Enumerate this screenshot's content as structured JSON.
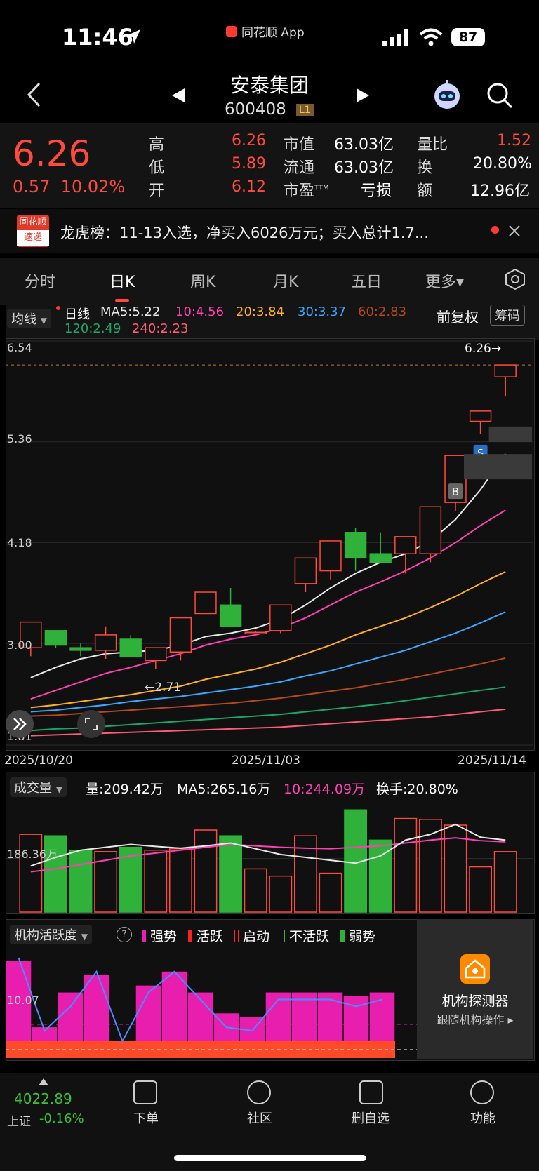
{
  "status": {
    "time": "11:46",
    "app": "同花顺 App",
    "battery": "87"
  },
  "header": {
    "title": "安泰集团",
    "code": "600408",
    "level": "L1"
  },
  "quote": {
    "price": "6.26",
    "change": "0.57",
    "pct": "10.02%",
    "high_label": "高",
    "high": "6.26",
    "low_label": "低",
    "low": "5.89",
    "open_label": "开",
    "open": "6.12",
    "mktcap_label": "市值",
    "mktcap": "63.03亿",
    "float_label": "流通",
    "float": "63.03亿",
    "pe_label": "市盈",
    "pe_sup": "TTM",
    "pe": "亏损",
    "volratio_label": "量比",
    "volratio": "1.52",
    "turnover_label": "换",
    "turnover": "20.80%",
    "amount_label": "额",
    "amount": "12.96亿"
  },
  "news": {
    "badge_top": "同花顺",
    "badge_bottom": "速递",
    "text": "龙虎榜：11-13入选，净买入6026万元；买入总计1.7..."
  },
  "tabs": [
    "分时",
    "日K",
    "周K",
    "月K",
    "五日",
    "更多▾"
  ],
  "active_tab": "日K",
  "indicators": {
    "selector": "均线",
    "period": "日线",
    "ma5": "MA5:5.22",
    "ma10": "10:4.56",
    "ma20": "20:3.84",
    "ma30": "30:3.37",
    "ma60": "60:2.83",
    "ma120": "120:2.49",
    "ma240": "240:2.23",
    "adjust": "前复权",
    "chips": "筹码"
  },
  "colors": {
    "up": "#ff4a3d",
    "down": "#2fb13a",
    "ma5": "#e8e8e8",
    "ma10": "#ff3fb4",
    "ma20": "#ffb020",
    "ma30": "#3aa7ff",
    "ma60": "#b84a1a",
    "ma120": "#1aa86a",
    "ma240": "#ff5a7a"
  },
  "chart_data": [
    {
      "type": "candlestick",
      "y_ticks": [
        "6.54",
        "5.36",
        "4.18",
        "3.00",
        "1.81"
      ],
      "ylim": [
        1.81,
        6.54
      ],
      "x_labels": [
        "2025/10/20",
        "2025/11/03",
        "2025/11/14"
      ],
      "last_price_marker": "6.26→",
      "low_marker": "←2.71",
      "trade_markers": [
        "B",
        "S"
      ],
      "candles": [
        {
          "o": 2.95,
          "h": 3.25,
          "l": 2.85,
          "c": 3.25
        },
        {
          "o": 3.15,
          "h": 3.15,
          "l": 2.95,
          "c": 2.98
        },
        {
          "o": 2.95,
          "h": 3.0,
          "l": 2.85,
          "c": 2.92
        },
        {
          "o": 2.92,
          "h": 3.2,
          "l": 2.82,
          "c": 3.1
        },
        {
          "o": 3.05,
          "h": 3.1,
          "l": 2.85,
          "c": 2.85
        },
        {
          "o": 2.8,
          "h": 2.95,
          "l": 2.7,
          "c": 2.95
        },
        {
          "o": 2.9,
          "h": 3.3,
          "l": 2.8,
          "c": 3.3
        },
        {
          "o": 3.35,
          "h": 3.6,
          "l": 3.35,
          "c": 3.6
        },
        {
          "o": 3.45,
          "h": 3.65,
          "l": 3.2,
          "c": 3.2
        },
        {
          "o": 3.12,
          "h": 3.15,
          "l": 3.1,
          "c": 3.13
        },
        {
          "o": 3.15,
          "h": 3.45,
          "l": 3.12,
          "c": 3.45
        },
        {
          "o": 3.7,
          "h": 4.0,
          "l": 3.6,
          "c": 4.0
        },
        {
          "o": 3.85,
          "h": 4.2,
          "l": 3.75,
          "c": 4.2
        },
        {
          "o": 4.3,
          "h": 4.35,
          "l": 3.85,
          "c": 4.0
        },
        {
          "o": 4.05,
          "h": 4.3,
          "l": 3.95,
          "c": 3.95
        },
        {
          "o": 4.05,
          "h": 4.25,
          "l": 3.82,
          "c": 4.25
        },
        {
          "o": 4.05,
          "h": 4.6,
          "l": 3.95,
          "c": 4.6
        },
        {
          "o": 4.65,
          "h": 5.2,
          "l": 4.55,
          "c": 5.2
        },
        {
          "o": 5.6,
          "h": 5.72,
          "l": 5.45,
          "c": 5.72
        },
        {
          "o": 6.12,
          "h": 6.26,
          "l": 5.89,
          "c": 6.26
        }
      ],
      "ma5": [
        2.6,
        2.72,
        2.82,
        2.88,
        2.9,
        2.92,
        2.98,
        3.08,
        3.12,
        3.18,
        3.28,
        3.45,
        3.65,
        3.82,
        3.95,
        4.05,
        4.2,
        4.45,
        4.8,
        5.22
      ],
      "ma10": [
        2.35,
        2.45,
        2.55,
        2.65,
        2.72,
        2.8,
        2.88,
        2.98,
        3.05,
        3.1,
        3.18,
        3.3,
        3.45,
        3.6,
        3.72,
        3.85,
        4.0,
        4.18,
        4.38,
        4.56
      ],
      "ma20": [
        2.25,
        2.28,
        2.32,
        2.36,
        2.4,
        2.45,
        2.5,
        2.58,
        2.64,
        2.7,
        2.78,
        2.88,
        2.98,
        3.1,
        3.2,
        3.3,
        3.42,
        3.55,
        3.7,
        3.84
      ],
      "ma30": [
        2.2,
        2.22,
        2.25,
        2.28,
        2.32,
        2.35,
        2.38,
        2.42,
        2.46,
        2.5,
        2.55,
        2.62,
        2.68,
        2.76,
        2.84,
        2.92,
        3.02,
        3.12,
        3.24,
        3.37
      ],
      "ma60": [
        2.15,
        2.16,
        2.18,
        2.2,
        2.22,
        2.24,
        2.26,
        2.28,
        2.3,
        2.33,
        2.36,
        2.4,
        2.44,
        2.48,
        2.53,
        2.58,
        2.64,
        2.7,
        2.76,
        2.83
      ],
      "ma120": [
        1.98,
        2.0,
        2.01,
        2.03,
        2.05,
        2.07,
        2.09,
        2.11,
        2.13,
        2.15,
        2.17,
        2.2,
        2.23,
        2.26,
        2.29,
        2.33,
        2.37,
        2.41,
        2.45,
        2.49
      ],
      "ma240": [
        1.92,
        1.93,
        1.94,
        1.95,
        1.96,
        1.97,
        1.98,
        1.99,
        2.0,
        2.01,
        2.02,
        2.04,
        2.06,
        2.08,
        2.1,
        2.12,
        2.14,
        2.17,
        2.2,
        2.23
      ]
    },
    {
      "type": "bar",
      "title": "成交量",
      "stats": {
        "vol": "量:209.42万",
        "ma5": "MA5:265.16万",
        "ma10": "10:244.09万",
        "turnover": "换手:20.80%"
      },
      "y_tick": "186.36万",
      "values": [
        270,
        265,
        215,
        210,
        225,
        215,
        220,
        285,
        265,
        150,
        125,
        265,
        135,
        355,
        250,
        325,
        322,
        302,
        157,
        210
      ],
      "up": [
        true,
        false,
        false,
        true,
        false,
        true,
        true,
        true,
        false,
        true,
        true,
        true,
        true,
        false,
        false,
        true,
        true,
        true,
        true,
        true
      ],
      "ma5": [
        160,
        190,
        215,
        225,
        235,
        228,
        222,
        230,
        240,
        220,
        200,
        190,
        180,
        170,
        195,
        250,
        270,
        305,
        260,
        250
      ],
      "ma10": [
        140,
        150,
        165,
        180,
        195,
        205,
        215,
        225,
        235,
        230,
        225,
        222,
        220,
        225,
        230,
        240,
        250,
        258,
        248,
        244
      ]
    },
    {
      "type": "bar",
      "title": "机构活跃度",
      "legend": [
        "强势",
        "活跃",
        "启动",
        "不活跃",
        "弱势"
      ],
      "y_tick": "10.07",
      "values": [
        23,
        4,
        14,
        19,
        0,
        16,
        20,
        14,
        8,
        7,
        14,
        14,
        14,
        13,
        14
      ],
      "line": [
        24,
        3,
        10,
        20,
        0,
        14,
        20,
        12,
        4,
        3,
        12,
        12,
        12,
        10,
        12
      ]
    }
  ],
  "detector": {
    "title": "机构探测器",
    "sub": "跟随机构操作 ▸"
  },
  "market": {
    "index": "4022.89",
    "name": "上证",
    "chg": "-0.16%"
  },
  "nav": [
    "下单",
    "社区",
    "删自选",
    "功能"
  ]
}
